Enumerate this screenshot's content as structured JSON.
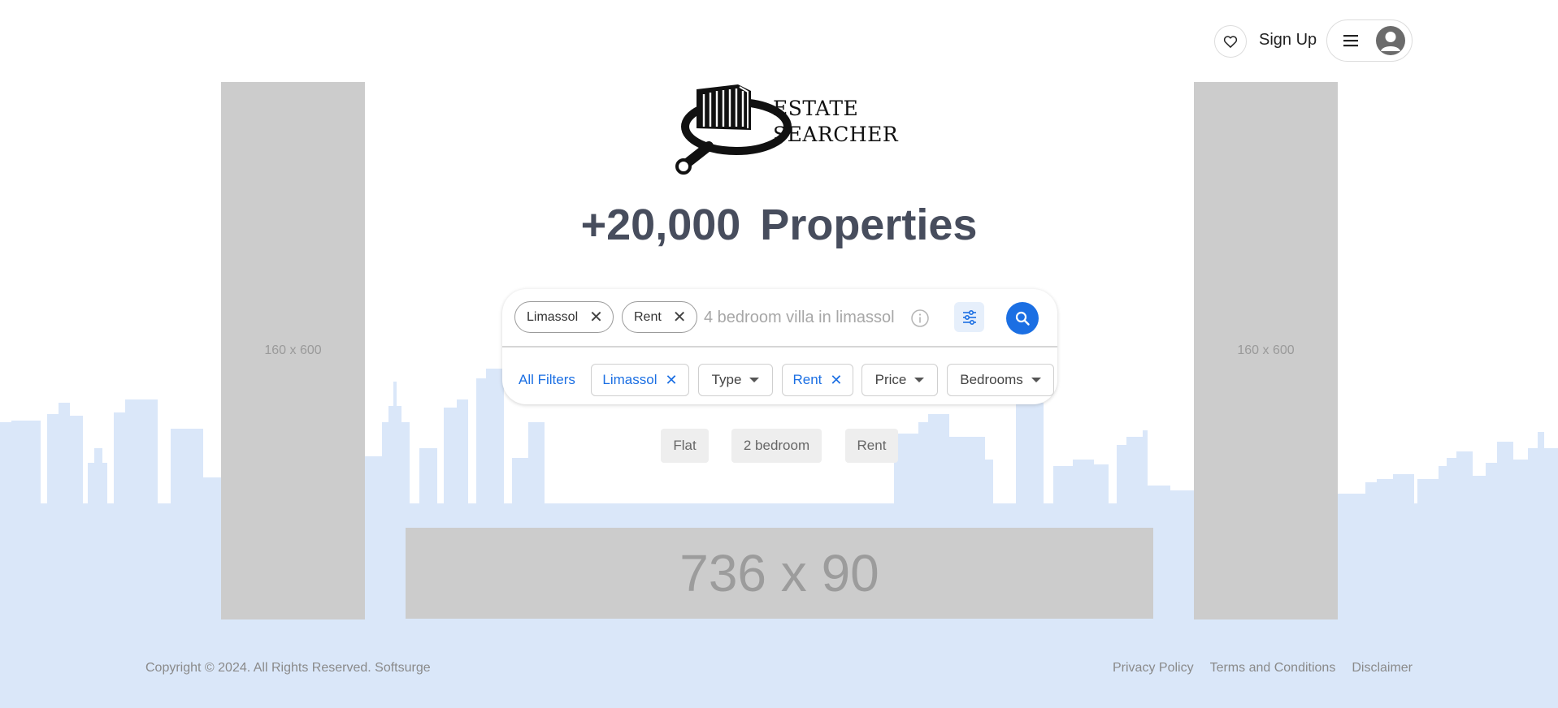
{
  "header": {
    "signup_label": "Sign Up",
    "icons": {
      "favorite": "heart-outline-icon",
      "menu": "hamburger-icon",
      "account": "user-avatar-icon"
    }
  },
  "brand": {
    "name_line1": "ESTATE",
    "name_line2": "SEARCHER"
  },
  "headline": {
    "count": "+20,000",
    "label": "Properties"
  },
  "search": {
    "chips": [
      {
        "label": "Limassol"
      },
      {
        "label": "Rent"
      }
    ],
    "placeholder": "4 bedroom villa in limassol",
    "icons": {
      "info": "info-icon",
      "filters": "sliders-icon",
      "submit": "search-icon"
    }
  },
  "filters": {
    "all_label": "All Filters",
    "items": [
      {
        "label": "Limassol",
        "active": true
      },
      {
        "label": "Type",
        "active": false
      },
      {
        "label": "Rent",
        "active": true
      },
      {
        "label": "Price",
        "active": false
      },
      {
        "label": "Bedrooms",
        "active": false
      }
    ]
  },
  "suggestions": [
    "Flat",
    "2 bedroom",
    "Rent"
  ],
  "ads": {
    "left": "160 x 600",
    "right": "160 x 600",
    "banner": "736 x 90"
  },
  "footer": {
    "copyright": "Copyright © 2024. All Rights Reserved. Softsurge",
    "links": [
      "Privacy Policy",
      "Terms and Conditions",
      "Disclaimer"
    ]
  },
  "colors": {
    "accent": "#1b6fe3",
    "skyline": "#dae7f9",
    "headline": "#474d5d",
    "ad_placeholder": "#cccccc"
  }
}
